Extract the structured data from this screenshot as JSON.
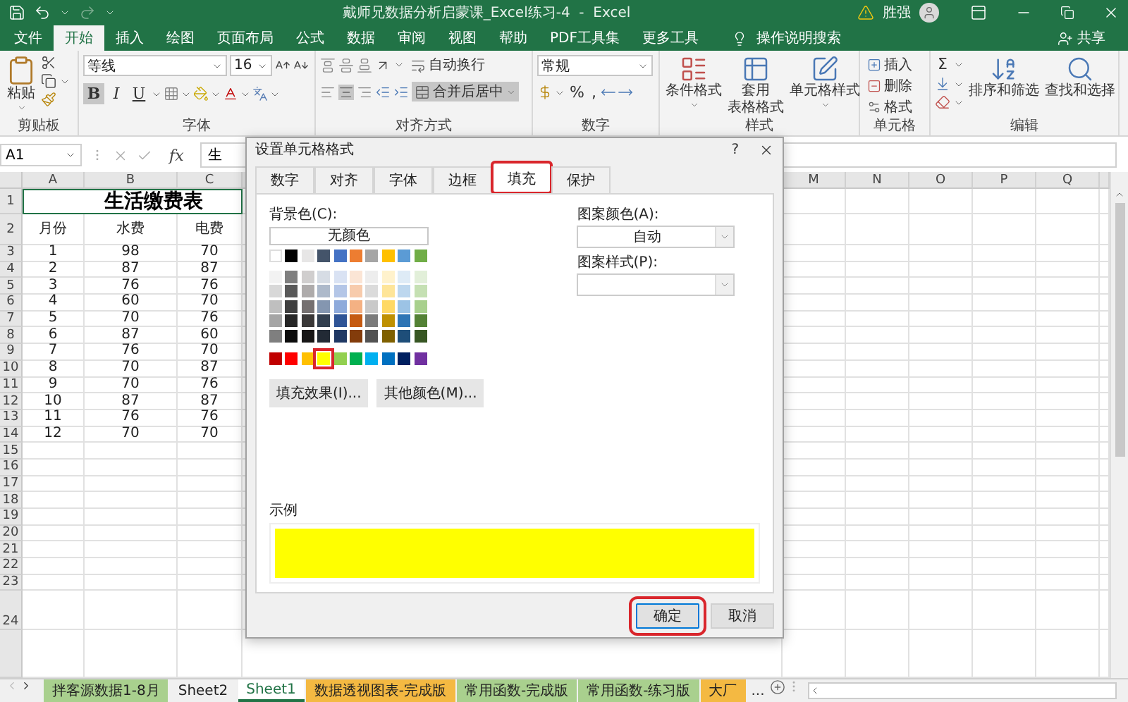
{
  "title_bar": {
    "title": "戴师兄数据分析启蒙课_Excel练习-4  -  Excel",
    "user": "胜强"
  },
  "menu_tabs": [
    {
      "label": "文件",
      "selected": false
    },
    {
      "label": "开始",
      "selected": true
    },
    {
      "label": "插入",
      "selected": false
    },
    {
      "label": "绘图",
      "selected": false
    },
    {
      "label": "页面布局",
      "selected": false
    },
    {
      "label": "公式",
      "selected": false
    },
    {
      "label": "数据",
      "selected": false
    },
    {
      "label": "审阅",
      "selected": false
    },
    {
      "label": "视图",
      "selected": false
    },
    {
      "label": "帮助",
      "selected": false
    },
    {
      "label": "PDF工具集",
      "selected": false
    },
    {
      "label": "更多工具",
      "selected": false
    }
  ],
  "tell_me": "操作说明搜索",
  "share": "共享",
  "ribbon": {
    "clipboard": {
      "label": "剪贴板",
      "paste": "粘贴"
    },
    "font": {
      "label": "字体",
      "name": "等线",
      "size": "16",
      "bold": "B",
      "italic": "I",
      "underline": "U",
      "bold_on": true
    },
    "alignment": {
      "label": "对齐方式",
      "wrap": "自动换行",
      "merge": "合并后居中",
      "center_on": true,
      "merge_on": true
    },
    "number": {
      "label": "数字",
      "format": "常规",
      "percent": "%",
      "comma": ","
    },
    "styles": {
      "label": "样式",
      "conditional": "条件格式",
      "table_lines": [
        "套用",
        "表格格式"
      ],
      "cell_styles": "单元格样式"
    },
    "cells": {
      "label": "单元格",
      "insert": "插入",
      "delete": "删除",
      "format": "格式"
    },
    "editing": {
      "label": "编辑",
      "sum": "Σ",
      "sort": "排序和筛选",
      "find": "查找和选择"
    }
  },
  "formula_bar": {
    "name_box": "A1",
    "function_label": "fx",
    "content": "生"
  },
  "sheet": {
    "columns": [
      "A",
      "B",
      "C",
      "M",
      "N",
      "O",
      "P",
      "Q"
    ],
    "title": {
      "header": "1",
      "text": "生活缴费表",
      "selected": true
    },
    "rows": [
      {
        "header": "2",
        "cells": [
          "月份",
          "水费",
          "电费"
        ]
      },
      {
        "header": "3",
        "cells": [
          "1",
          "98",
          "70"
        ]
      },
      {
        "header": "4",
        "cells": [
          "2",
          "87",
          "87"
        ]
      },
      {
        "header": "5",
        "cells": [
          "3",
          "76",
          "76"
        ]
      },
      {
        "header": "6",
        "cells": [
          "4",
          "60",
          "70"
        ]
      },
      {
        "header": "7",
        "cells": [
          "5",
          "70",
          "76"
        ]
      },
      {
        "header": "8",
        "cells": [
          "6",
          "87",
          "60"
        ]
      },
      {
        "header": "9",
        "cells": [
          "7",
          "76",
          "70"
        ]
      },
      {
        "header": "10",
        "cells": [
          "8",
          "70",
          "87"
        ]
      },
      {
        "header": "11",
        "cells": [
          "9",
          "70",
          "76"
        ]
      },
      {
        "header": "12",
        "cells": [
          "10",
          "87",
          "87"
        ]
      },
      {
        "header": "13",
        "cells": [
          "11",
          "76",
          "76"
        ]
      },
      {
        "header": "14",
        "cells": [
          "12",
          "70",
          "70"
        ]
      },
      {
        "header": "15"
      },
      {
        "header": "16"
      },
      {
        "header": "17"
      },
      {
        "header": "18"
      },
      {
        "header": "19"
      },
      {
        "header": "20"
      },
      {
        "header": "21"
      },
      {
        "header": "22"
      },
      {
        "header": "23"
      },
      {
        "header": "24"
      }
    ]
  },
  "sheet_tabs": [
    {
      "label": "拌客源数据1-8月",
      "color": "#a9d08e",
      "selected": false
    },
    {
      "label": "Sheet2",
      "color": "#f0f0f0",
      "selected": false
    },
    {
      "label": "Sheet1",
      "color": "#ffffff",
      "selected": true
    },
    {
      "label": "数据透视图表-完成版",
      "color": "#f4b942",
      "selected": false
    },
    {
      "label": "常用函数-完成版",
      "color": "#a9d08e",
      "selected": false
    },
    {
      "label": "常用函数-练习版",
      "color": "#a9d08e",
      "selected": false
    },
    {
      "label": "大厂",
      "color": "#f4b942",
      "selected": false
    }
  ],
  "more_tabs": "...",
  "dialog": {
    "title": "设置单元格格式",
    "help": "?",
    "tabs": [
      {
        "label": "数字",
        "selected": false,
        "highlighted": false
      },
      {
        "label": "对齐",
        "selected": false,
        "highlighted": false
      },
      {
        "label": "字体",
        "selected": false,
        "highlighted": false
      },
      {
        "label": "边框",
        "selected": false,
        "highlighted": false
      },
      {
        "label": "填充",
        "selected": true,
        "highlighted": true
      },
      {
        "label": "保护",
        "selected": false,
        "highlighted": false
      }
    ],
    "background_label": "背景色(C):",
    "no_color": "无颜色",
    "swatch_rows": [
      {
        "kind": "theme",
        "swatches": [
          {
            "color": "#ffffff",
            "selected": false
          },
          {
            "color": "#000000",
            "selected": false
          },
          {
            "color": "#e7e6e6",
            "selected": false
          },
          {
            "color": "#44546a",
            "selected": false
          },
          {
            "color": "#4472c4",
            "selected": false
          },
          {
            "color": "#ed7d31",
            "selected": false
          },
          {
            "color": "#a5a5a5",
            "selected": false
          },
          {
            "color": "#ffc000",
            "selected": false
          },
          {
            "color": "#5b9bd5",
            "selected": false
          },
          {
            "color": "#70ad47",
            "selected": false
          }
        ]
      },
      {
        "kind": "tint",
        "swatches": [
          {
            "color": "#f2f2f2",
            "selected": false
          },
          {
            "color": "#7f7f7f",
            "selected": false
          },
          {
            "color": "#d0cece",
            "selected": false
          },
          {
            "color": "#d6dce4",
            "selected": false
          },
          {
            "color": "#d9e2f3",
            "selected": false
          },
          {
            "color": "#fbe5d5",
            "selected": false
          },
          {
            "color": "#ededed",
            "selected": false
          },
          {
            "color": "#fff2cc",
            "selected": false
          },
          {
            "color": "#deebf6",
            "selected": false
          },
          {
            "color": "#e2efd9",
            "selected": false
          }
        ]
      },
      {
        "kind": "tint",
        "swatches": [
          {
            "color": "#d8d8d8",
            "selected": false
          },
          {
            "color": "#595959",
            "selected": false
          },
          {
            "color": "#aeabab",
            "selected": false
          },
          {
            "color": "#adb9ca",
            "selected": false
          },
          {
            "color": "#b4c6e7",
            "selected": false
          },
          {
            "color": "#f7cbac",
            "selected": false
          },
          {
            "color": "#dbdbdb",
            "selected": false
          },
          {
            "color": "#fee599",
            "selected": false
          },
          {
            "color": "#bdd7ee",
            "selected": false
          },
          {
            "color": "#c5e0b3",
            "selected": false
          }
        ]
      },
      {
        "kind": "tint",
        "swatches": [
          {
            "color": "#bfbfbf",
            "selected": false
          },
          {
            "color": "#3f3f3f",
            "selected": false
          },
          {
            "color": "#757070",
            "selected": false
          },
          {
            "color": "#8496b0",
            "selected": false
          },
          {
            "color": "#8eaadb",
            "selected": false
          },
          {
            "color": "#f4b183",
            "selected": false
          },
          {
            "color": "#c9c9c9",
            "selected": false
          },
          {
            "color": "#ffd965",
            "selected": false
          },
          {
            "color": "#9cc3e5",
            "selected": false
          },
          {
            "color": "#a8d08d",
            "selected": false
          }
        ]
      },
      {
        "kind": "tint",
        "swatches": [
          {
            "color": "#a5a5a5",
            "selected": false
          },
          {
            "color": "#262626",
            "selected": false
          },
          {
            "color": "#3a3838",
            "selected": false
          },
          {
            "color": "#323f4f",
            "selected": false
          },
          {
            "color": "#2f5496",
            "selected": false
          },
          {
            "color": "#c55a11",
            "selected": false
          },
          {
            "color": "#7b7b7b",
            "selected": false
          },
          {
            "color": "#bf9000",
            "selected": false
          },
          {
            "color": "#2e75b5",
            "selected": false
          },
          {
            "color": "#538135",
            "selected": false
          }
        ]
      },
      {
        "kind": "tint",
        "swatches": [
          {
            "color": "#7f7f7f",
            "selected": false
          },
          {
            "color": "#0c0c0c",
            "selected": false
          },
          {
            "color": "#171616",
            "selected": false
          },
          {
            "color": "#222a35",
            "selected": false
          },
          {
            "color": "#1f3864",
            "selected": false
          },
          {
            "color": "#833c0b",
            "selected": false
          },
          {
            "color": "#525252",
            "selected": false
          },
          {
            "color": "#7f6000",
            "selected": false
          },
          {
            "color": "#1e4e79",
            "selected": false
          },
          {
            "color": "#375623",
            "selected": false
          }
        ]
      },
      {
        "kind": "standard",
        "swatches": [
          {
            "color": "#c00000",
            "selected": false
          },
          {
            "color": "#ff0000",
            "selected": false
          },
          {
            "color": "#ffc000",
            "selected": false
          },
          {
            "color": "#ffff00",
            "selected": true
          },
          {
            "color": "#92d050",
            "selected": false
          },
          {
            "color": "#00b050",
            "selected": false
          },
          {
            "color": "#00b0f0",
            "selected": false
          },
          {
            "color": "#0070c0",
            "selected": false
          },
          {
            "color": "#002060",
            "selected": false
          },
          {
            "color": "#7030a0",
            "selected": false
          }
        ]
      }
    ],
    "fill_buttons": [
      "填充效果(I)...",
      "其他颜色(M)..."
    ],
    "pattern_color_label": "图案颜色(A):",
    "pattern_color": "自动",
    "pattern_style_label": "图案样式(P):",
    "sample_label": "示例",
    "buttons": [
      {
        "label": "确定",
        "highlighted": true
      },
      {
        "label": "取消",
        "highlighted": false
      }
    ]
  }
}
